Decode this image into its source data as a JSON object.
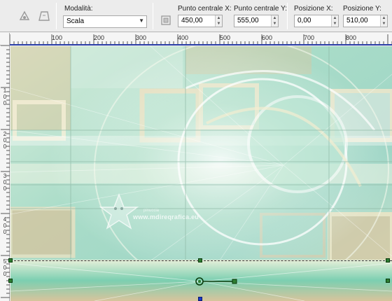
{
  "toolbar": {
    "mode_label": "Modalità:",
    "mode_value": "Scala",
    "center_x_label": "Punto centrale X:",
    "center_x_value": "450,00",
    "center_y_label": "Punto centrale Y:",
    "center_y_value": "555,00",
    "pos_x_label": "Posizione X:",
    "pos_x_value": "0,00",
    "pos_y_label": "Posizione Y:",
    "pos_y_value": "510,00"
  },
  "ruler": {
    "top_ticks": [
      "100",
      "200",
      "300",
      "400",
      "500",
      "600",
      "700",
      "800"
    ],
    "left_ticks": [
      "1\n0\n0",
      "2\n0\n0",
      "3\n0\n0",
      "4\n0\n0",
      "5\n0\n0"
    ]
  },
  "watermark": {
    "text": "www.mdireqrafica.eu",
    "small": "pinuccia"
  },
  "colors": {
    "toolbar_bg": "#ececec",
    "ruler_bg": "#f5f5f5",
    "selection_blue": "#2b3fa8",
    "node_green": "#2e7d32"
  }
}
